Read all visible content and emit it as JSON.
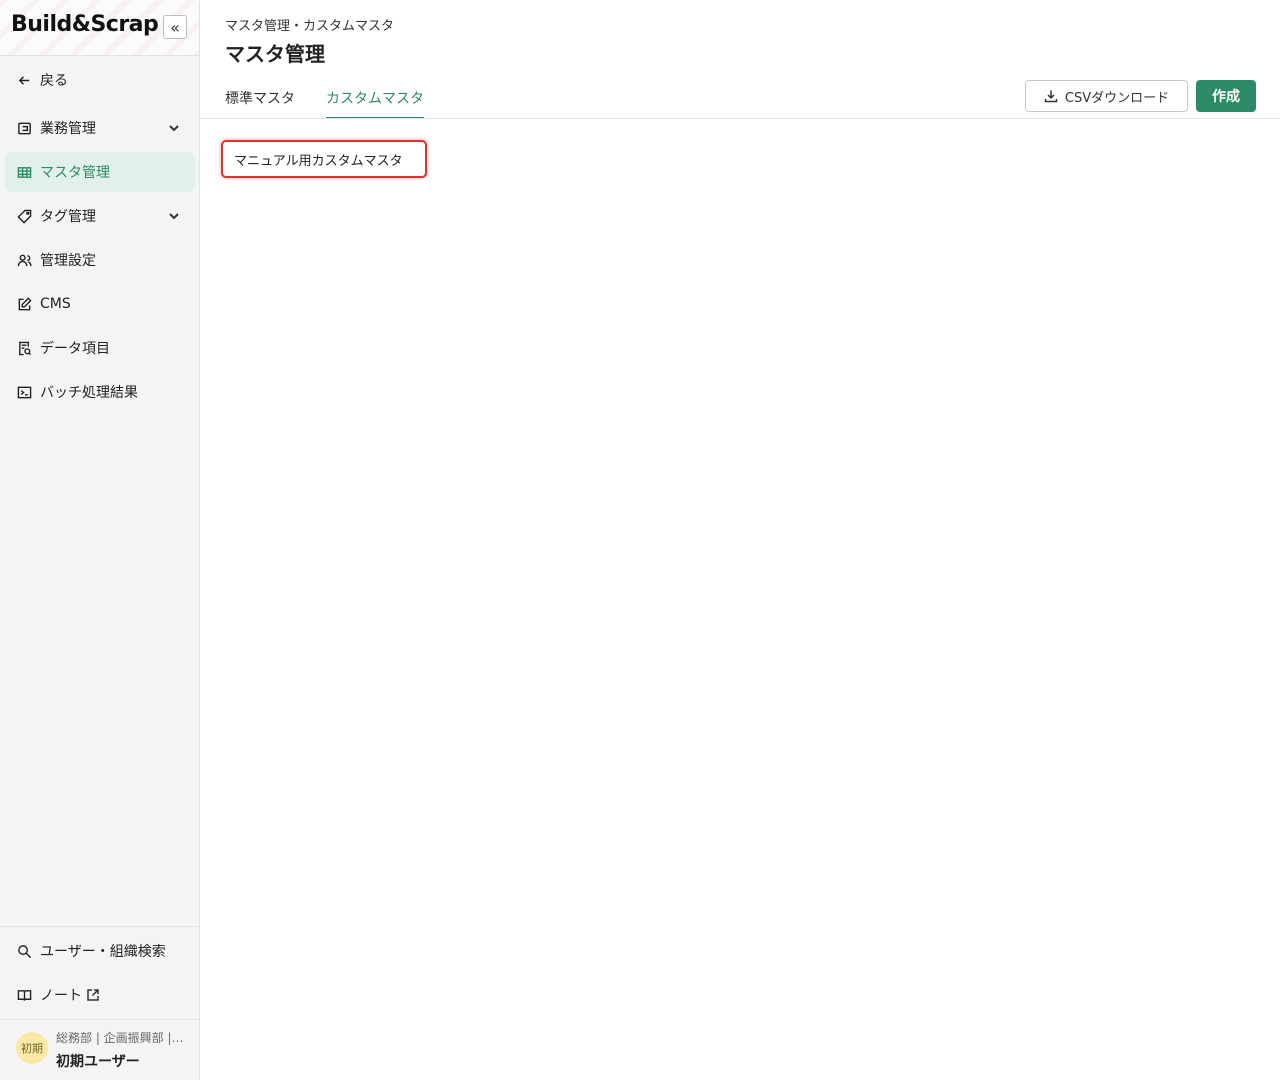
{
  "app": {
    "logo": "Build&Scrap"
  },
  "sidebar": {
    "back_label": "戻る",
    "items": [
      {
        "label": "業務管理",
        "icon": "briefcase-icon",
        "has_chevron": true
      },
      {
        "label": "マスタ管理",
        "icon": "table-icon",
        "active": true
      },
      {
        "label": "タグ管理",
        "icon": "tag-icon",
        "has_chevron": true
      },
      {
        "label": "管理設定",
        "icon": "users-icon"
      },
      {
        "label": "CMS",
        "icon": "edit-icon"
      },
      {
        "label": "データ項目",
        "icon": "document-search-icon"
      },
      {
        "label": "バッチ処理結果",
        "icon": "terminal-icon"
      }
    ],
    "bottom_items": [
      {
        "label": "ユーザー・組織検索",
        "icon": "search-icon"
      },
      {
        "label": "ノート",
        "icon": "book-icon",
        "external": true
      }
    ],
    "user": {
      "avatar_text": "初期",
      "org": "総務部 | 企画振興部 | …",
      "name": "初期ユーザー"
    }
  },
  "header": {
    "breadcrumb": "マスタ管理・カスタムマスタ",
    "title": "マスタ管理"
  },
  "tabs": [
    {
      "label": "標準マスタ",
      "active": false
    },
    {
      "label": "カスタムマスタ",
      "active": true
    }
  ],
  "actions": {
    "csv_label": "CSVダウンロード",
    "create_label": "作成"
  },
  "masters": [
    {
      "label": "マニュアル用カスタムマスタ"
    }
  ],
  "colors": {
    "accent": "#2c8b66",
    "active_bg": "#e2f0ea",
    "highlight": "#e03131"
  }
}
